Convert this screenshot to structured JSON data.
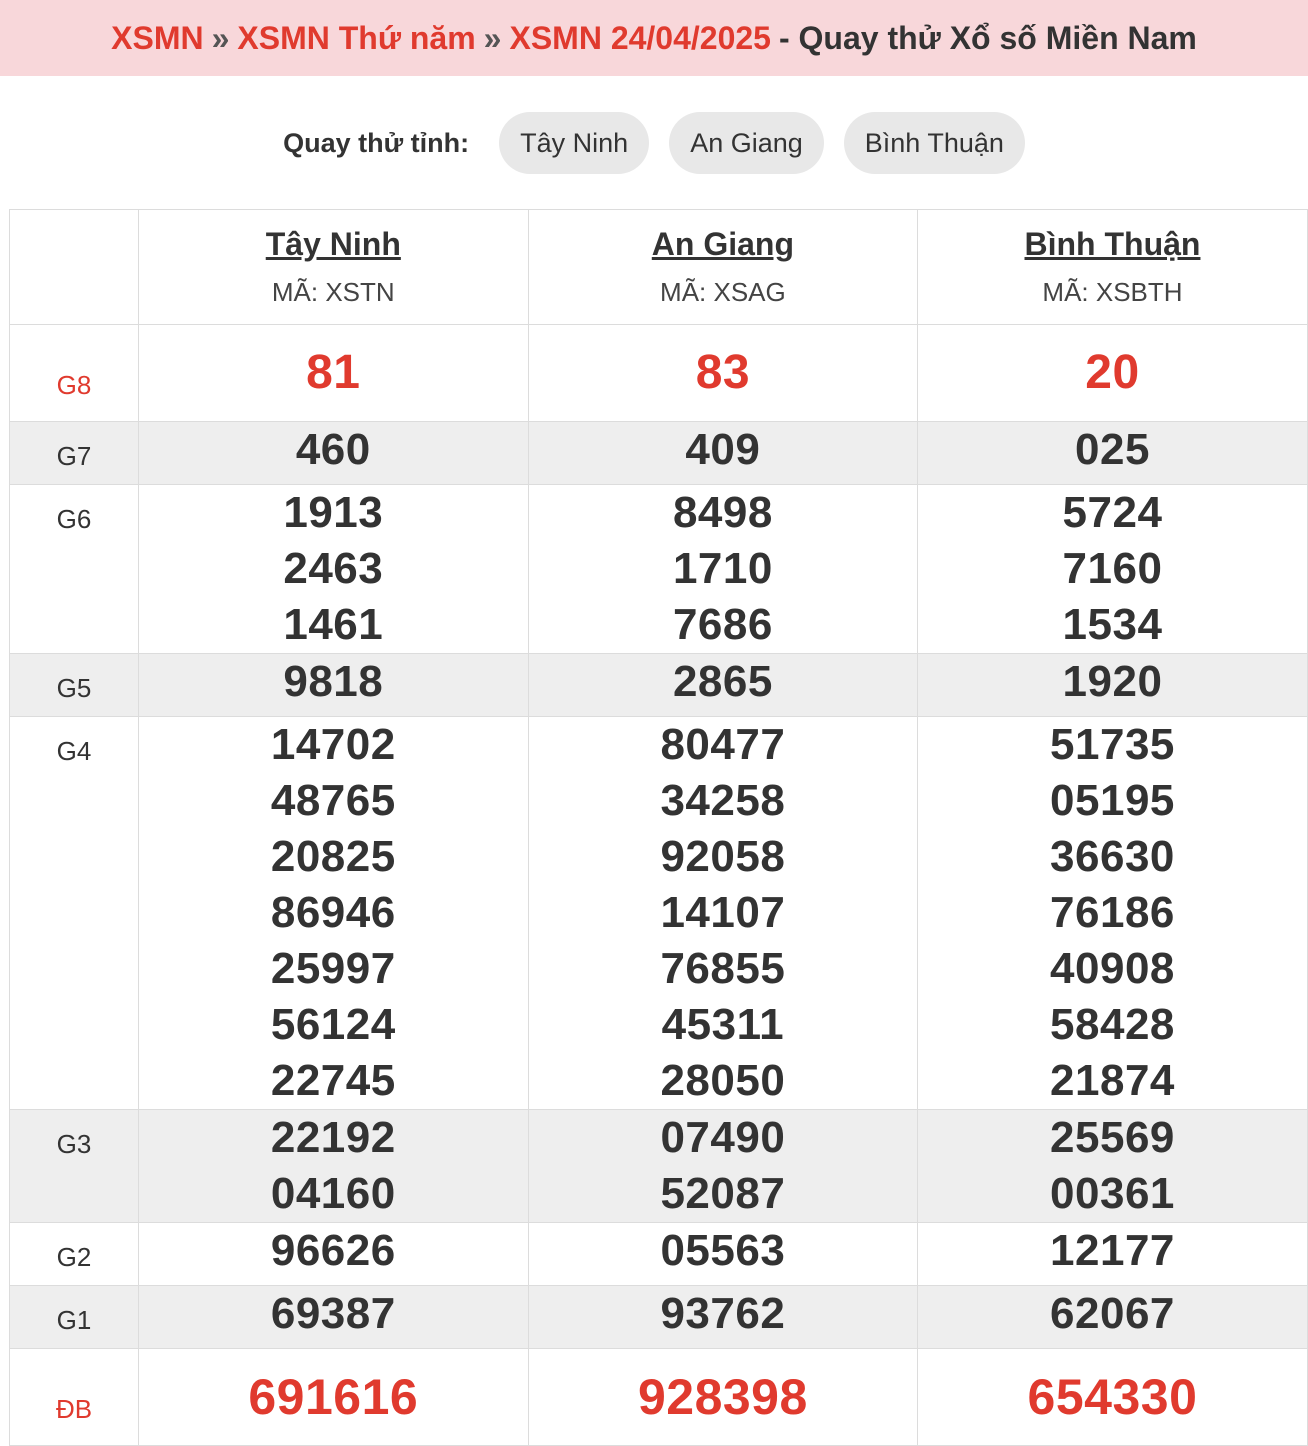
{
  "breadcrumb": {
    "item1": "XSMN",
    "sep": "»",
    "item2": "XSMN Thứ năm",
    "item3": "XSMN 24/04/2025",
    "tail": "- Quay thử Xổ số Miền Nam"
  },
  "try": {
    "label": "Quay thử tỉnh:",
    "options": [
      "Tây Ninh",
      "An Giang",
      "Bình Thuận"
    ]
  },
  "provinces": [
    {
      "name": "Tây Ninh",
      "code": "MÃ: XSTN"
    },
    {
      "name": "An Giang",
      "code": "MÃ: XSAG"
    },
    {
      "name": "Bình Thuận",
      "code": "MÃ: XSBTH"
    }
  ],
  "prizes": [
    {
      "label": "G8",
      "values": [
        [
          "81"
        ],
        [
          "83"
        ],
        [
          "20"
        ]
      ]
    },
    {
      "label": "G7",
      "values": [
        [
          "460"
        ],
        [
          "409"
        ],
        [
          "025"
        ]
      ]
    },
    {
      "label": "G6",
      "values": [
        [
          "1913",
          "2463",
          "1461"
        ],
        [
          "8498",
          "1710",
          "7686"
        ],
        [
          "5724",
          "7160",
          "1534"
        ]
      ]
    },
    {
      "label": "G5",
      "values": [
        [
          "9818"
        ],
        [
          "2865"
        ],
        [
          "1920"
        ]
      ]
    },
    {
      "label": "G4",
      "values": [
        [
          "14702",
          "48765",
          "20825",
          "86946",
          "25997",
          "56124",
          "22745"
        ],
        [
          "80477",
          "34258",
          "92058",
          "14107",
          "76855",
          "45311",
          "28050"
        ],
        [
          "51735",
          "05195",
          "36630",
          "76186",
          "40908",
          "58428",
          "21874"
        ]
      ]
    },
    {
      "label": "G3",
      "values": [
        [
          "22192",
          "04160"
        ],
        [
          "07490",
          "52087"
        ],
        [
          "25569",
          "00361"
        ]
      ]
    },
    {
      "label": "G2",
      "values": [
        [
          "96626"
        ],
        [
          "05563"
        ],
        [
          "12177"
        ]
      ]
    },
    {
      "label": "G1",
      "values": [
        [
          "69387"
        ],
        [
          "93762"
        ],
        [
          "62067"
        ]
      ]
    },
    {
      "label": "ĐB",
      "values": [
        [
          "691616"
        ],
        [
          "928398"
        ],
        [
          "654330"
        ]
      ]
    }
  ],
  "colors": {
    "accent": "#e03a2e",
    "header_bg": "#f8d7da",
    "alt_row": "#eeeeee"
  }
}
